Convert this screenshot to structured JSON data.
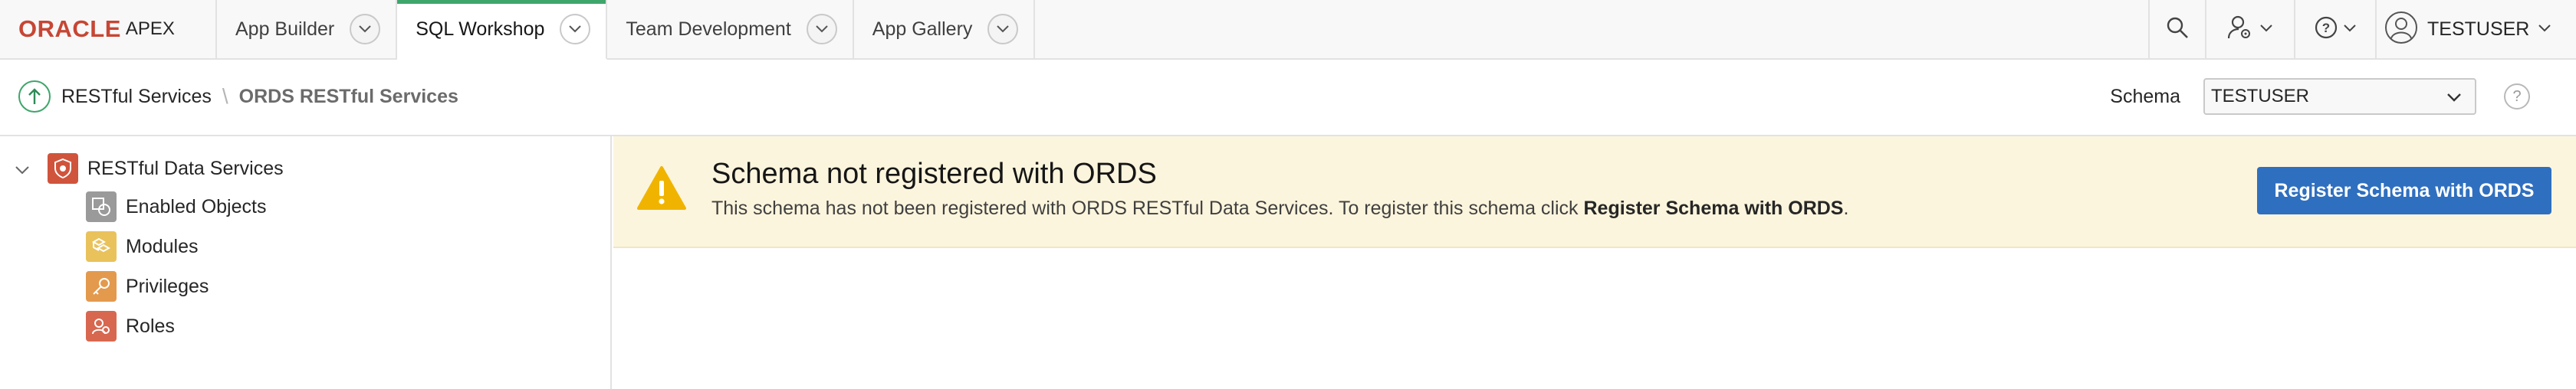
{
  "brand": {
    "oracle": "ORACLE",
    "product": "APEX",
    "accent": "#c74634"
  },
  "nav": {
    "tabs": [
      {
        "label": "App Builder",
        "active": false
      },
      {
        "label": "SQL Workshop",
        "active": true
      },
      {
        "label": "Team Development",
        "active": false
      },
      {
        "label": "App Gallery",
        "active": false
      }
    ],
    "active_color": "#3fa66b"
  },
  "toolbar": {
    "search_icon": "search-icon",
    "admin_icon": "user-settings-icon",
    "help_icon": "help-icon",
    "user_name": "TESTUSER"
  },
  "breadcrumb": {
    "parent": "RESTful Services",
    "separator": "\\",
    "current": "ORDS RESTful Services"
  },
  "schema": {
    "label": "Schema",
    "value": "TESTUSER"
  },
  "tree": {
    "root": "RESTful Data Services",
    "items": [
      {
        "label": "Enabled Objects",
        "icon": "enabled-objects-icon"
      },
      {
        "label": "Modules",
        "icon": "modules-icon"
      },
      {
        "label": "Privileges",
        "icon": "privileges-icon"
      },
      {
        "label": "Roles",
        "icon": "roles-icon"
      }
    ]
  },
  "alert": {
    "title": "Schema not registered with ORDS",
    "message": "This schema has not been registered with ORDS RESTful Data Services. To register this schema click ",
    "message_bold": "Register Schema with ORDS",
    "message_end": ".",
    "button": "Register Schema with ORDS",
    "warning_color": "#f0b400",
    "button_color": "#2f6fbf"
  }
}
